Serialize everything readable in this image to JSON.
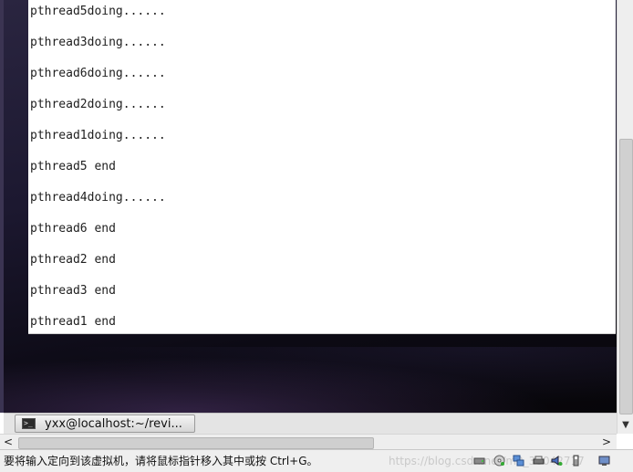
{
  "terminal": {
    "lines": [
      "pthread5doing......",
      "pthread3doing......",
      "pthread6doing......",
      "pthread2doing......",
      "pthread1doing......",
      "pthread5 end",
      "pthread4doing......",
      "pthread6 end",
      "pthread2 end",
      "pthread3 end",
      "pthread1 end"
    ]
  },
  "taskbar": {
    "window_button_label": "yxx@localhost:~/revi..."
  },
  "statusbar": {
    "hint": "要将输入定向到该虚拟机，请将鼠标指针移入其中或按 Ctrl+G。",
    "watermark": "https://blog.csdn.net/m0_38042717"
  },
  "scroll": {
    "left_arrow": "<",
    "right_arrow": ">",
    "down_arrow": "▼"
  },
  "tray_icons": [
    "hard-disk-icon",
    "cd-rom-icon",
    "network-icon",
    "printer-icon",
    "sound-icon",
    "usb-icon",
    "display-icon"
  ],
  "colors": {
    "terminal_bg": "#ffffff",
    "terminal_text": "#1e1e1e",
    "desktop_dark": "#1c1830"
  }
}
